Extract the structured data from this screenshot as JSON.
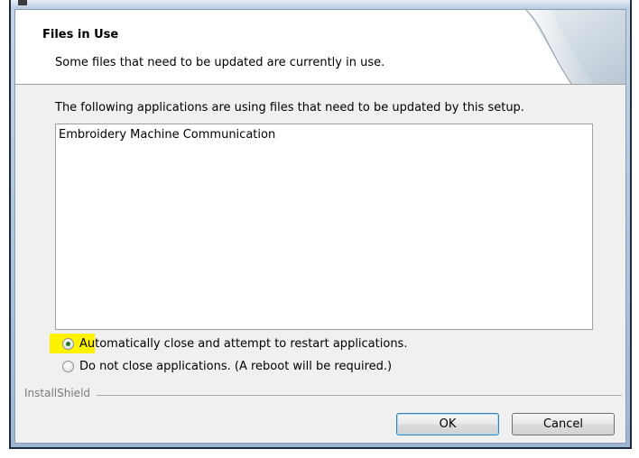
{
  "window": {
    "title": ""
  },
  "header": {
    "title": "Files in Use",
    "subtitle": "Some files that need to be updated are currently in use."
  },
  "main": {
    "description": "The following applications are using files that need to be updated by this setup.",
    "applications": [
      "Embroidery Machine Communication"
    ],
    "options": [
      {
        "label": "Automatically close and attempt to restart applications.",
        "selected": true
      },
      {
        "label": "Do not close applications. (A reboot will be required.)",
        "selected": false
      }
    ]
  },
  "footer": {
    "brand": "InstallShield",
    "ok_label": "OK",
    "cancel_label": "Cancel"
  },
  "colors": {
    "highlight": "#fff200",
    "radio_selected": "#1d7a1d",
    "ok_border": "#3c7fb1"
  }
}
